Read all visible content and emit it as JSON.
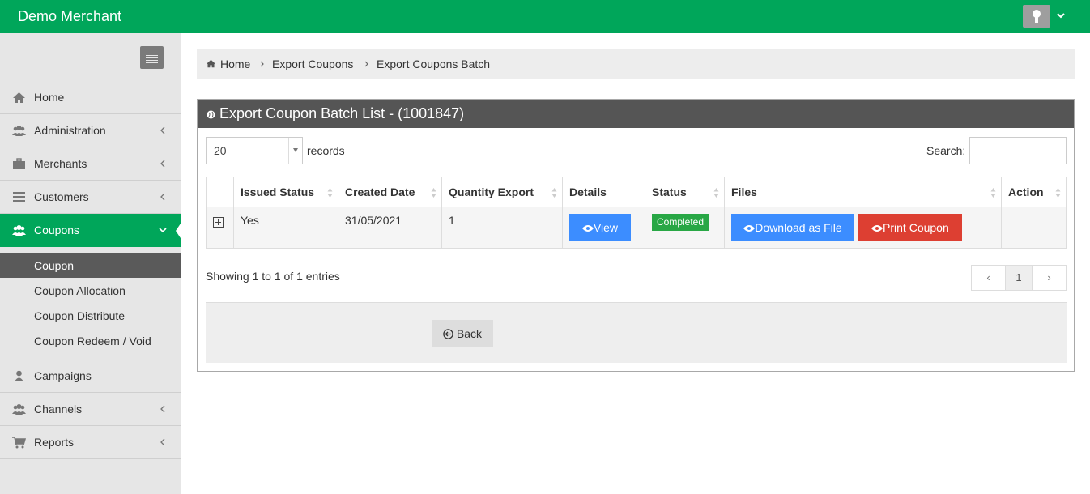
{
  "app": {
    "title": "Demo Merchant"
  },
  "sidebar": {
    "items": [
      {
        "label": "Home",
        "icon": "home-icon"
      },
      {
        "label": "Administration",
        "icon": "users-icon"
      },
      {
        "label": "Merchants",
        "icon": "briefcase-icon"
      },
      {
        "label": "Customers",
        "icon": "list-icon"
      },
      {
        "label": "Coupons",
        "icon": "users-icon"
      },
      {
        "label": "Campaigns",
        "icon": "user-icon"
      },
      {
        "label": "Channels",
        "icon": "users-icon"
      },
      {
        "label": "Reports",
        "icon": "cart-icon"
      }
    ],
    "sub_items": [
      {
        "label": "Coupon"
      },
      {
        "label": "Coupon Allocation"
      },
      {
        "label": "Coupon Distribute"
      },
      {
        "label": "Coupon Redeem / Void"
      }
    ]
  },
  "breadcrumb": {
    "items": [
      "Home",
      "Export Coupons",
      "Export Coupons Batch"
    ]
  },
  "panel": {
    "title": "Export Coupon Batch List - (1001847)"
  },
  "controls": {
    "page_length": "20",
    "records_label": "records",
    "search_label": "Search:",
    "search_value": ""
  },
  "table": {
    "headers": [
      "Issued Status",
      "Created Date",
      "Quantity Export",
      "Details",
      "Status",
      "Files",
      "Action"
    ],
    "rows": [
      {
        "issued_status": "Yes",
        "created_date": "31/05/2021",
        "quantity_export": "1",
        "details_button": "View",
        "status": "Completed",
        "download_button": "Download as File",
        "print_button": "Print Coupon"
      }
    ]
  },
  "info": {
    "showing": "Showing 1 to 1 of 1 entries"
  },
  "pagination": {
    "prev": "‹",
    "current": "1",
    "next": "›"
  },
  "footer": {
    "back_label": "Back"
  },
  "colors": {
    "brand": "#00a65a",
    "panel_header": "#555555",
    "view_button": "#3c8dff",
    "print_button": "#dd3f32",
    "status_badge": "#28a745"
  }
}
